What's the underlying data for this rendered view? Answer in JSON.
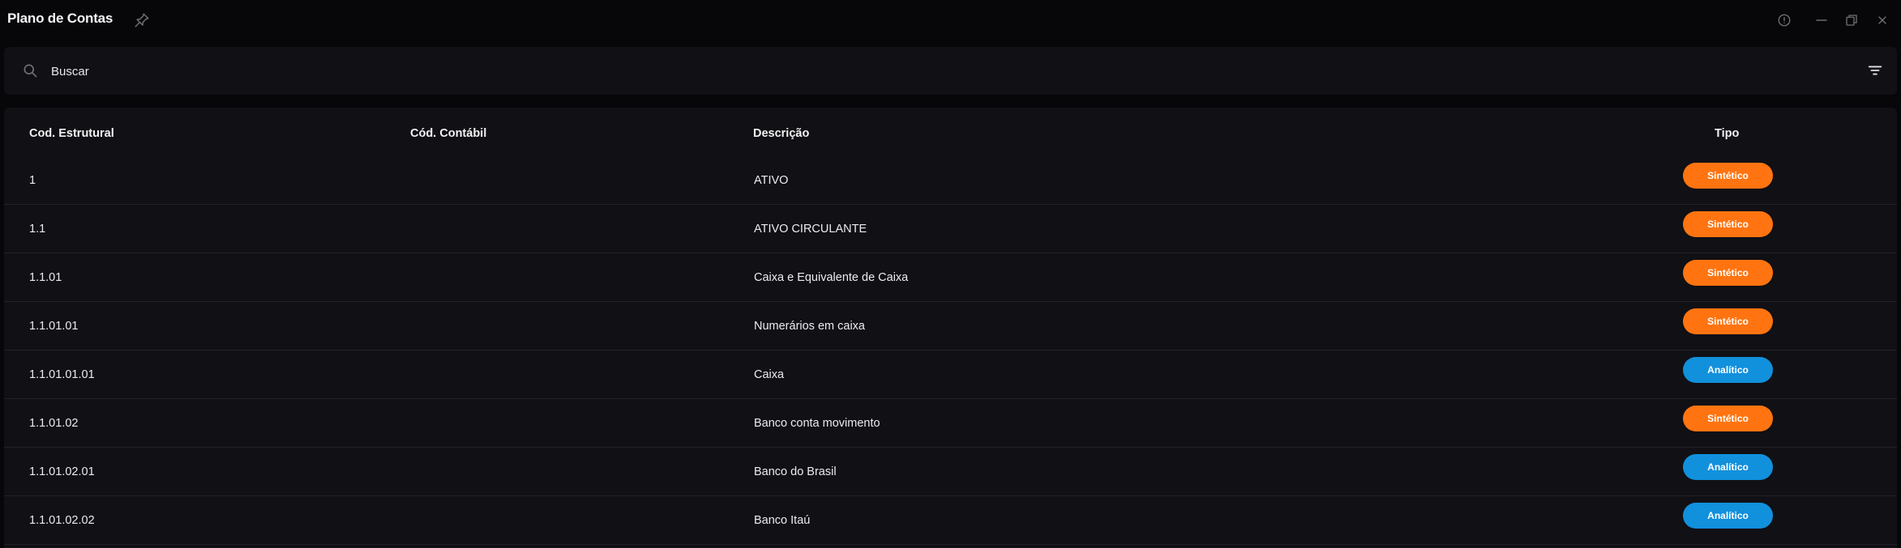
{
  "window": {
    "title": "Plano de Contas",
    "pin_icon": "pin-icon",
    "info_icon": "info-icon",
    "minimize_icon": "minimize-icon",
    "restore_icon": "restore-icon",
    "close_icon": "close-icon"
  },
  "search": {
    "placeholder": "Buscar",
    "icon": "search-icon",
    "filter_icon": "filter-icon"
  },
  "table": {
    "headers": {
      "cod_estrutural": "Cod. Estrutural",
      "cod_contabil": "Cód. Contábil",
      "descricao": "Descrição",
      "tipo": "Tipo"
    },
    "rows": [
      {
        "cod_estrutural": "1",
        "cod_contabil": "",
        "descricao": "ATIVO",
        "tipo": "Sintético",
        "tipo_kind": "sintetico"
      },
      {
        "cod_estrutural": "1.1",
        "cod_contabil": "",
        "descricao": "ATIVO CIRCULANTE",
        "tipo": "Sintético",
        "tipo_kind": "sintetico"
      },
      {
        "cod_estrutural": "1.1.01",
        "cod_contabil": "",
        "descricao": "Caixa e Equivalente de Caixa",
        "tipo": "Sintético",
        "tipo_kind": "sintetico"
      },
      {
        "cod_estrutural": "1.1.01.01",
        "cod_contabil": "",
        "descricao": "Numerários em caixa",
        "tipo": "Sintético",
        "tipo_kind": "sintetico"
      },
      {
        "cod_estrutural": "1.1.01.01.01",
        "cod_contabil": "",
        "descricao": "Caixa",
        "tipo": "Analítico",
        "tipo_kind": "analitico"
      },
      {
        "cod_estrutural": "1.1.01.02",
        "cod_contabil": "",
        "descricao": "Banco conta movimento",
        "tipo": "Sintético",
        "tipo_kind": "sintetico"
      },
      {
        "cod_estrutural": "1.1.01.02.01",
        "cod_contabil": "",
        "descricao": "Banco do Brasil",
        "tipo": "Analítico",
        "tipo_kind": "analitico"
      },
      {
        "cod_estrutural": "1.1.01.02.02",
        "cod_contabil": "",
        "descricao": "Banco Itaú",
        "tipo": "Analítico",
        "tipo_kind": "analitico"
      }
    ]
  },
  "colors": {
    "background": "#070709",
    "panel": "#101015",
    "sintetico": "#ff7410",
    "analitico": "#1190dc",
    "icon_gray": "#707078"
  }
}
